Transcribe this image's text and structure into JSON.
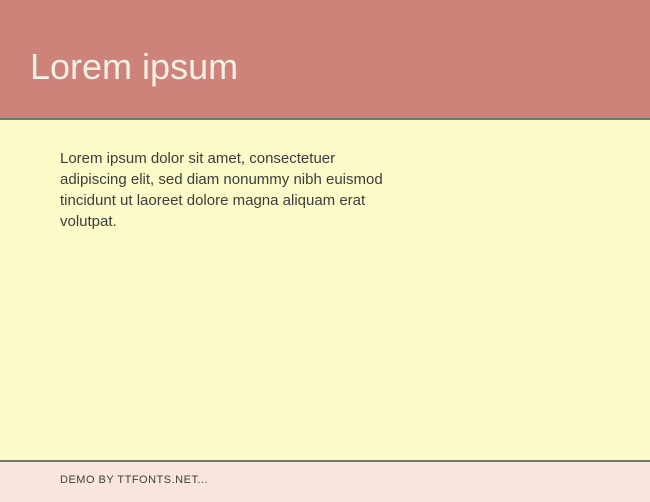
{
  "header": {
    "title": "Lorem ipsum"
  },
  "body": {
    "paragraph": "Lorem ipsum dolor sit amet, consectetuer adipiscing elit, sed diam nonummy nibh euismod tincidunt ut laoreet dolore magna aliquam erat volutpat."
  },
  "footer": {
    "text": "DEMO BY TTFONTS.NET..."
  }
}
